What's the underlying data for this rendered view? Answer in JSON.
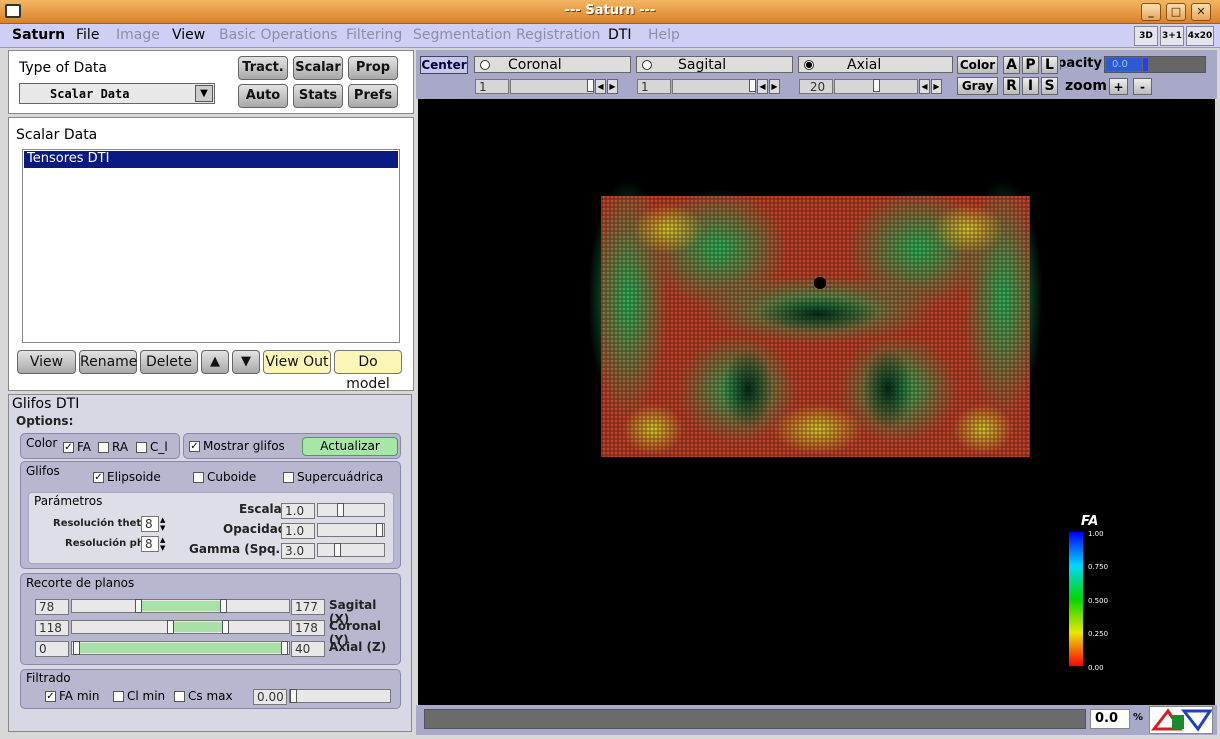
{
  "window": {
    "title": "--- Saturn ---"
  },
  "menu": {
    "items": [
      "Saturn",
      "File",
      "Image",
      "View",
      "Basic Operations",
      "Filtering",
      "Segmentation",
      "Registration",
      "DTI",
      "Help"
    ],
    "right": [
      "3D",
      "3+1",
      "4x20"
    ]
  },
  "type_panel": {
    "label": "Type of Data",
    "select_value": "Scalar Data",
    "buttons": [
      "Tract.",
      "Scalar",
      "Prop",
      "Auto",
      "Stats",
      "Prefs"
    ]
  },
  "scalar_panel": {
    "label": "Scalar Data",
    "items": [
      "Tensores DTI"
    ],
    "buttons": [
      "View",
      "Rename",
      "Delete",
      "View Out",
      "Do model"
    ]
  },
  "glifos": {
    "title": "Glifos DTI",
    "options": "Options:",
    "color": {
      "label": "Color",
      "fa": "FA",
      "ra": "RA",
      "ci": "C_l",
      "mostrar": "Mostrar glifos",
      "actualizar": "Actualizar"
    },
    "glyphs": {
      "label": "Glifos",
      "elipsoide": "Elipsoide",
      "cuboide": "Cuboide",
      "supercuadrica": "Supercuádrica"
    },
    "params": {
      "label": "Parámetros",
      "res_theta_label": "Resolución theta",
      "res_theta": "8",
      "res_phi_label": "Resolución phi",
      "res_phi": "8",
      "escala_label": "Escala",
      "escala": "1.0",
      "opacidad_label": "Opacidad",
      "opacidad": "1.0",
      "gamma_label": "Gamma (Spq.)",
      "gamma": "3.0"
    },
    "recorte": {
      "label": "Recorte de planos",
      "rows": [
        {
          "min": "78",
          "max": "177",
          "axis": "Sagital (X)"
        },
        {
          "min": "118",
          "max": "178",
          "axis": "Coronal (Y)"
        },
        {
          "min": "0",
          "max": "40",
          "axis": "Axial (Z)"
        }
      ]
    },
    "filtrado": {
      "label": "Filtrado",
      "fa": "FA min",
      "cl": "Cl min",
      "cs": "Cs max",
      "value": "0.00"
    }
  },
  "viewer": {
    "center": "Center",
    "planes": [
      {
        "name": "Coronal",
        "value": "1"
      },
      {
        "name": "Sagital",
        "value": "1"
      },
      {
        "name": "Axial",
        "value": "20"
      }
    ],
    "color": "Color",
    "gray": "Gray",
    "apl": [
      "A",
      "P",
      "L"
    ],
    "ris": [
      "R",
      "I",
      "S"
    ],
    "opacity_label": "opacity",
    "opacity_value": "0.0",
    "zoom_label": "zoom",
    "zoom_plus": "+",
    "zoom_minus": "-"
  },
  "colorbar": {
    "title": "FA",
    "ticks": [
      "1.00",
      "0.750",
      "0.500",
      "0.250",
      "0.00"
    ]
  },
  "status": {
    "value": "0.0",
    "unit": "%"
  }
}
